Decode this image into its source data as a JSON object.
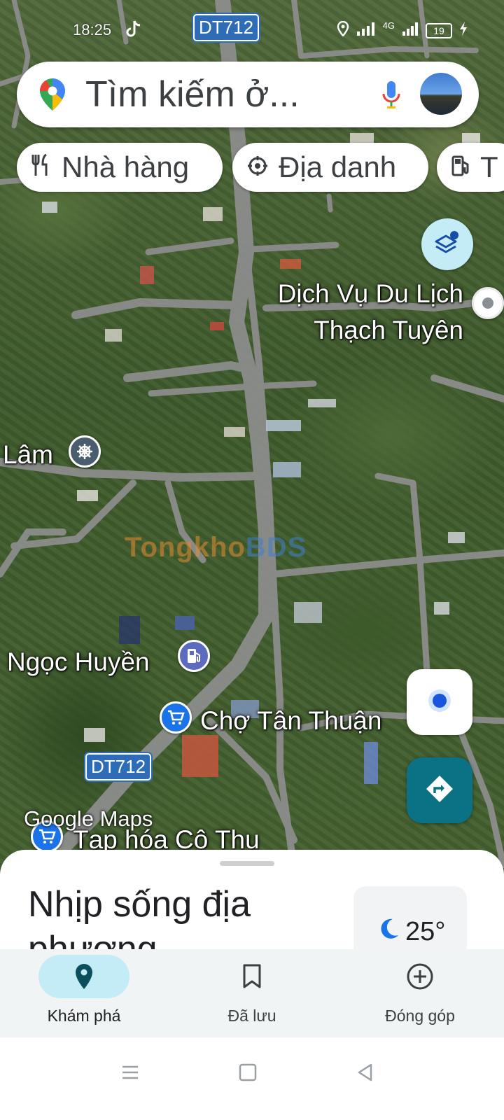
{
  "status_bar": {
    "time": "18:25",
    "network": "4G",
    "battery": "19"
  },
  "search": {
    "placeholder": "Tìm kiếm ở..."
  },
  "chips": [
    {
      "label": "Nhà hàng",
      "icon": "restaurant-icon"
    },
    {
      "label": "Địa danh",
      "icon": "landmark-icon"
    },
    {
      "label": "T",
      "icon": "gas-station-icon"
    }
  ],
  "map": {
    "road_shields": [
      "DT712",
      "DT712"
    ],
    "places": {
      "tour_service": "Dịch Vụ Du Lịch\nThạch Tuyên",
      "lam": "Lâm",
      "ngoc_huyen": "Ngọc Huyền",
      "cho_tan_thuan": "Chợ Tân Thuận",
      "tap_hoa": "Tạp hóa Cô Thu"
    },
    "watermark": {
      "part1": "Tongkho",
      "part2": "BDS"
    },
    "google_logo": "Google Maps",
    "colors": {
      "road": "#8e8e8e",
      "road_shield": "#2e6cb8",
      "shopping_pin": "#1a73e8",
      "gas_pin": "#5c6bc0",
      "directions": "#0b7285"
    }
  },
  "sheet": {
    "title": "Nhịp sống địa phương",
    "weather_temp": "25°"
  },
  "bottom_nav": [
    {
      "label": "Khám phá",
      "icon": "explore-pin-icon",
      "active": true
    },
    {
      "label": "Đã lưu",
      "icon": "bookmark-icon",
      "active": false
    },
    {
      "label": "Đóng góp",
      "icon": "add-circle-icon",
      "active": false
    }
  ]
}
